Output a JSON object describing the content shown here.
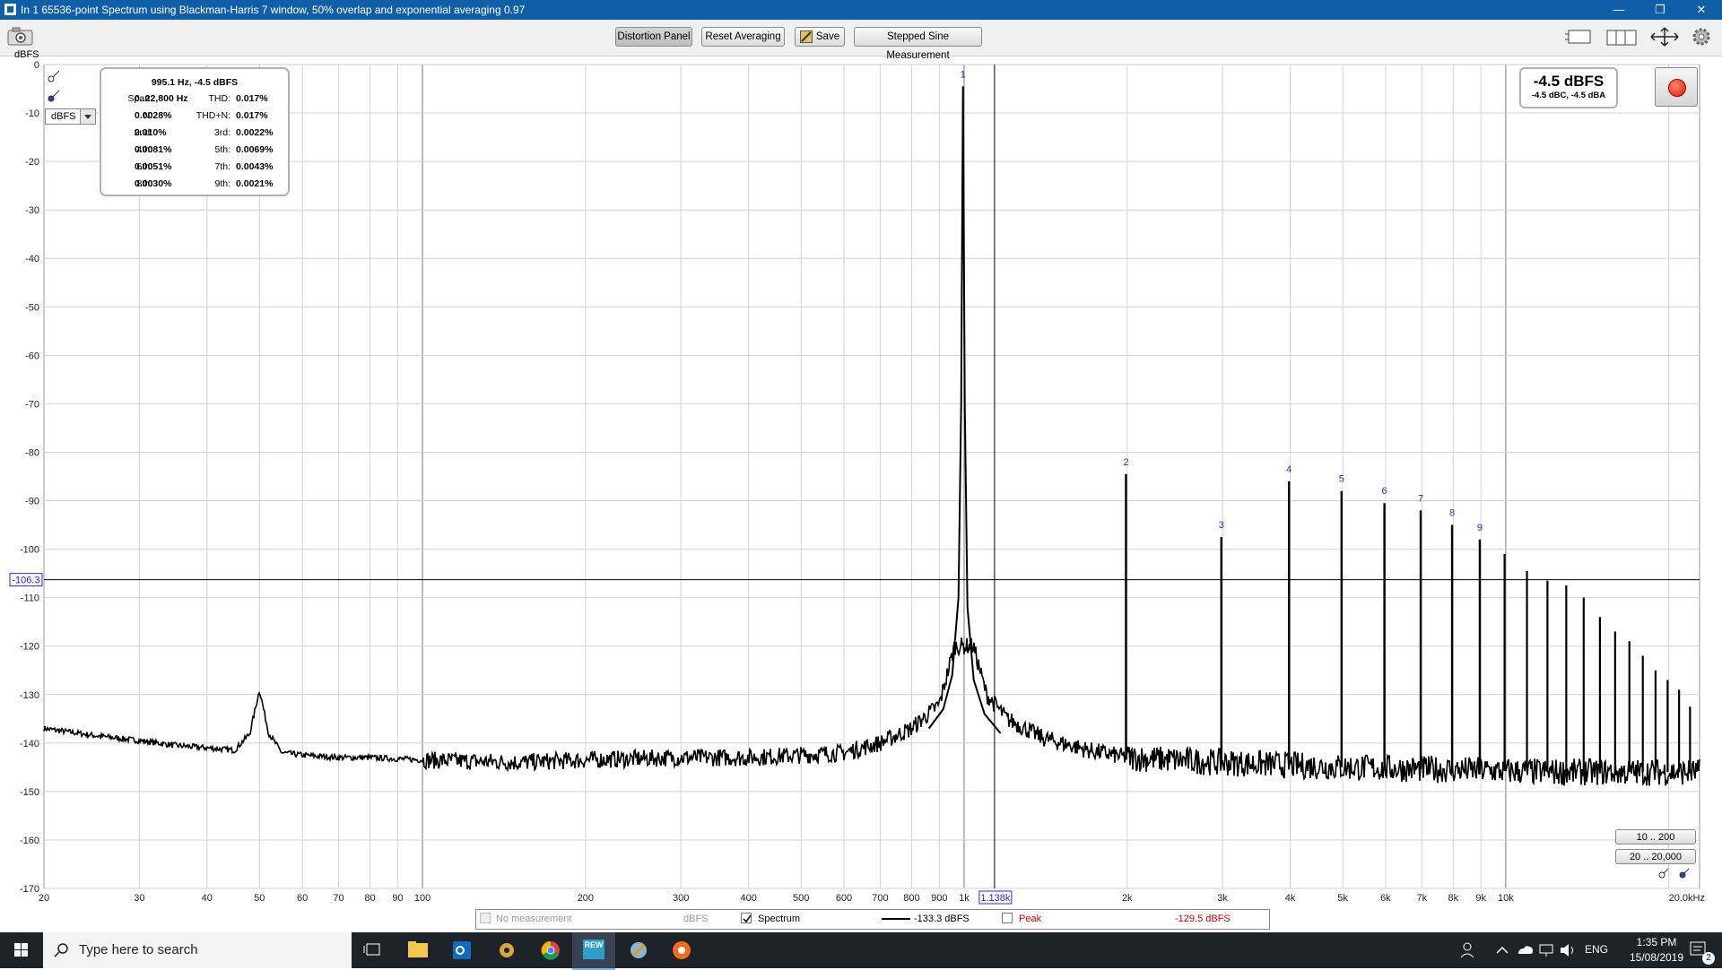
{
  "window": {
    "title": "In 1 65536-point Spectrum using Blackman-Harris 7 window, 50% overlap and exponential averaging 0.97",
    "minimize_glyph": "—",
    "restore_glyph": "❐",
    "close_glyph": "✕"
  },
  "toolbar": {
    "distortion_panel": "Distortion Panel",
    "reset_averaging": "Reset Averaging",
    "save": "Save",
    "stepped_sine": "Stepped Sine Measurement"
  },
  "units": {
    "axis_unit": "dBFS",
    "selected": "dBFS"
  },
  "distortion_panel": {
    "header": "995.1 Hz, -4.5 dBFS",
    "rows": [
      {
        "l1": "Span:",
        "v1": "0..22,800 Hz",
        "l2": "THD:",
        "v2": "0.017%"
      },
      {
        "l1": "N:",
        "v1": "0.0028%",
        "l2": "THD+N:",
        "v2": "0.017%"
      },
      {
        "l1": "2nd:",
        "v1": "0.010%",
        "l2": "3rd:",
        "v2": "0.0022%"
      },
      {
        "l1": "4th:",
        "v1": "0.0081%",
        "l2": "5th:",
        "v2": "0.0069%"
      },
      {
        "l1": "6th:",
        "v1": "0.0051%",
        "l2": "7th:",
        "v2": "0.0043%"
      },
      {
        "l1": "8th:",
        "v1": "0.0030%",
        "l2": "9th:",
        "v2": "0.0021%"
      }
    ]
  },
  "level_meter": {
    "main": "-4.5 dBFS",
    "sub": "-4.5 dBC, -4.5 dBA"
  },
  "range_buttons": {
    "y_range": "10 .. 200",
    "x_range": "20 .. 20,000"
  },
  "cursor": {
    "x_label": "1.138k",
    "y_label": "-106.3",
    "x": 1138,
    "y": -106.3
  },
  "legend": {
    "no_measurement": "No measurement",
    "no_measurement_unit": "dBFS",
    "spectrum": "Spectrum",
    "spectrum_value": "-133.3 dBFS",
    "peak": "Peak",
    "peak_value": "-129.5 dBFS",
    "peak_color": "#d40000"
  },
  "chart_data": {
    "type": "line",
    "xscale": "log",
    "xlim": [
      20,
      22800
    ],
    "ylim": [
      -170,
      0
    ],
    "ylabel": "dBFS",
    "grid": true,
    "x_ticks": [
      {
        "v": 20,
        "t": "20"
      },
      {
        "v": 30,
        "t": "30"
      },
      {
        "v": 40,
        "t": "40"
      },
      {
        "v": 50,
        "t": "50"
      },
      {
        "v": 60,
        "t": "60"
      },
      {
        "v": 70,
        "t": "70"
      },
      {
        "v": 80,
        "t": "80"
      },
      {
        "v": 90,
        "t": "90"
      },
      {
        "v": 100,
        "t": "100"
      },
      {
        "v": 200,
        "t": "200"
      },
      {
        "v": 300,
        "t": "300"
      },
      {
        "v": 400,
        "t": "400"
      },
      {
        "v": 500,
        "t": "500"
      },
      {
        "v": 600,
        "t": "600"
      },
      {
        "v": 700,
        "t": "700"
      },
      {
        "v": 800,
        "t": "800"
      },
      {
        "v": 900,
        "t": "900"
      },
      {
        "v": 1000,
        "t": "1k"
      },
      {
        "v": 2000,
        "t": "2k"
      },
      {
        "v": 3000,
        "t": "3k"
      },
      {
        "v": 4000,
        "t": "4k"
      },
      {
        "v": 5000,
        "t": "5k"
      },
      {
        "v": 6000,
        "t": "6k"
      },
      {
        "v": 7000,
        "t": "7k"
      },
      {
        "v": 8000,
        "t": "8k"
      },
      {
        "v": 9000,
        "t": "9k"
      },
      {
        "v": 10000,
        "t": "10k"
      },
      {
        "v": 20000,
        "t": "20.0kHz"
      }
    ],
    "y_ticks": [
      0,
      -10,
      -20,
      -30,
      -40,
      -50,
      -60,
      -70,
      -80,
      -90,
      -100,
      -110,
      -120,
      -130,
      -140,
      -150,
      -160,
      -170
    ],
    "fundamental": {
      "freq": 995.1,
      "level": -4.5
    },
    "harmonics": [
      {
        "n": "1",
        "freq": 995.1,
        "level": -4.5
      },
      {
        "n": "2",
        "freq": 1990,
        "level": -84.5
      },
      {
        "n": "3",
        "freq": 2985,
        "level": -97.5
      },
      {
        "n": "4",
        "freq": 3980,
        "level": -86.0
      },
      {
        "n": "5",
        "freq": 4976,
        "level": -88.0
      },
      {
        "n": "6",
        "freq": 5971,
        "level": -90.5
      },
      {
        "n": "7",
        "freq": 6966,
        "level": -92.0
      },
      {
        "n": "8",
        "freq": 7961,
        "level": -95.0
      },
      {
        "n": "9",
        "freq": 8956,
        "level": -98.0
      }
    ],
    "higher_harmonics": [
      {
        "freq": 9951,
        "level": -101.0
      },
      {
        "freq": 10946,
        "level": -104.5
      },
      {
        "freq": 11941,
        "level": -106.5
      },
      {
        "freq": 12936,
        "level": -107.5
      },
      {
        "freq": 13931,
        "level": -110.0
      },
      {
        "freq": 14927,
        "level": -114.0
      },
      {
        "freq": 15922,
        "level": -117.0
      },
      {
        "freq": 16917,
        "level": -119.0
      },
      {
        "freq": 17912,
        "level": -122.0
      },
      {
        "freq": 18907,
        "level": -125.0
      },
      {
        "freq": 19902,
        "level": -127.0
      },
      {
        "freq": 20897,
        "level": -129.0
      },
      {
        "freq": 21892,
        "level": -132.5
      }
    ],
    "noise_floor": [
      [
        20,
        -137.0
      ],
      [
        25,
        -138.5
      ],
      [
        30,
        -139.5
      ],
      [
        35,
        -140.5
      ],
      [
        40,
        -141.0
      ],
      [
        45,
        -141.5
      ],
      [
        48,
        -138.0
      ],
      [
        50,
        -129.0
      ],
      [
        52,
        -138.0
      ],
      [
        55,
        -142.0
      ],
      [
        60,
        -142.5
      ],
      [
        70,
        -143.0
      ],
      [
        80,
        -143.0
      ],
      [
        100,
        -143.5
      ],
      [
        150,
        -144.0
      ],
      [
        200,
        -143.5
      ],
      [
        300,
        -143.0
      ],
      [
        400,
        -143.0
      ],
      [
        500,
        -142.5
      ],
      [
        600,
        -142.0
      ],
      [
        700,
        -140.0
      ],
      [
        800,
        -137.0
      ],
      [
        900,
        -132.0
      ],
      [
        960,
        -120.0
      ],
      [
        1040,
        -120.0
      ],
      [
        1100,
        -130.0
      ],
      [
        1200,
        -135.0
      ],
      [
        1400,
        -139.0
      ],
      [
        1700,
        -141.5
      ],
      [
        2000,
        -143.0
      ],
      [
        3000,
        -144.0
      ],
      [
        5000,
        -145.0
      ],
      [
        8000,
        -145.5
      ],
      [
        12000,
        -146.0
      ],
      [
        22800,
        -146.0
      ]
    ]
  },
  "taskbar": {
    "search_placeholder": "Type here to search",
    "language": "ENG",
    "time": "1:35 PM",
    "date": "15/08/2019",
    "notification_count": "2",
    "rew_label": "REW"
  }
}
